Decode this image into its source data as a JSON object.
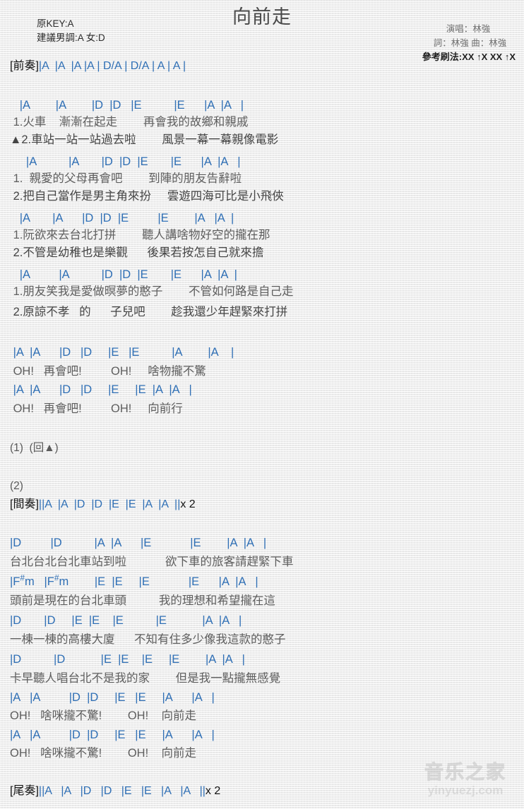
{
  "header": {
    "title": "向前走",
    "orig_key": "原KEY:A",
    "suggest_key": "建議男調:A 女:D",
    "singer": "演唱：林強",
    "writer": "詞：林強  曲：林強",
    "strumming": "參考刷法:XX ↑X XX ↑X"
  },
  "intro": {
    "tag": "[前奏]",
    "chords": "|A  |A  |A |A | D/A | D/A | A | A |"
  },
  "verse1": {
    "chord_line_1": "   |A        |A        |D  |D   |E          |E      |A  |A   |",
    "lyric_line_1": " 1.火車    漸漸在起走        再會我的故鄉和親戚",
    "lyric_line_2": "▲2.車站一站一站過去啦        風景一幕一幕親像電影",
    "chord_line_2": "     |A          |A       |D  |D  |E       |E      |A  |A   |",
    "lyric_line_3": " 1.  親愛的父母再會吧        到陣的朋友告辭啦",
    "lyric_line_4": " 2.把自己當作是男主角來扮     雲遊四海可比是小飛俠",
    "chord_line_3": "   |A       |A      |D  |D  |E         |E        |A   |A  |",
    "lyric_line_5": " 1.阮欲來去台北打拼        聽人講啥物好空的攏在那",
    "lyric_line_6": " 2.不管是幼稚也是樂觀      後果若按怎自己就來擔",
    "chord_line_4": "   |A         |A          |D  |D  |E       |E      |A  |A  |",
    "lyric_line_7": " 1.朋友笑我是愛做暝夢的憨子        不管如何路是自己走",
    "lyric_line_8": " 2.原諒不孝   的      子兒吧        趁我還少年趕緊來打拼"
  },
  "chorus1": {
    "chord_line_1": " |A  |A      |D   |D     |E   |E          |A        |A    |",
    "lyric_line_1": " OH!   再會吧!         OH!     啥物攏不驚",
    "chord_line_2": " |A  |A      |D   |D     |E     |E  |A  |A   |",
    "lyric_line_2": " OH!   再會吧!         OH!     向前行"
  },
  "markers": {
    "repeat_one": "(1)  (回▲)",
    "section_two": "(2)"
  },
  "interlude": {
    "tag": "[間奏]",
    "chords": "||A  |A  |D  |D  |E  |E  |A  |A  ||",
    "repeat": "x 2"
  },
  "verse2": {
    "chord_line_1": "|D         |D          |A  |A      |E            |E        |A  |A   |",
    "lyric_line_1": "台北台北台北車站到啦            欲下車的旅客請趕緊下車",
    "chord_line_2": "|F#m   |F#m        |E  |E     |E            |E      |A  |A   |",
    "lyric_line_2": "頭前是現在的台北車頭          我的理想和希望攏在這",
    "chord_line_3": "|D       |D     |E  |E    |E          |E           |A  |A   |",
    "lyric_line_3": "一棟一棟的高樓大廈      不知有住多少像我這款的憨子",
    "chord_line_4": "|D          |D           |E  |E    |E     |E        |A  |A   |",
    "lyric_line_4": "卡早聽人唱台北不是我的家        但是我一點攏無感覺"
  },
  "chorus2": {
    "chord_line_1": "|A   |A         |D  |D     |E   |E     |A      |A   |",
    "lyric_line_1": "OH!   啥咪攏不驚!        OH!    向前走",
    "chord_line_2": "|A   |A         |D  |D     |E   |E     |A      |A   |",
    "lyric_line_2": "OH!   啥咪攏不驚!        OH!    向前走"
  },
  "outro": {
    "tag": "[尾奏]",
    "chords": "||A   |A   |D   |D   |E   |E   |A   |A   ||",
    "repeat": "x 2"
  },
  "watermark": {
    "cn": "音乐之家",
    "en": "yinyuezj.com"
  }
}
